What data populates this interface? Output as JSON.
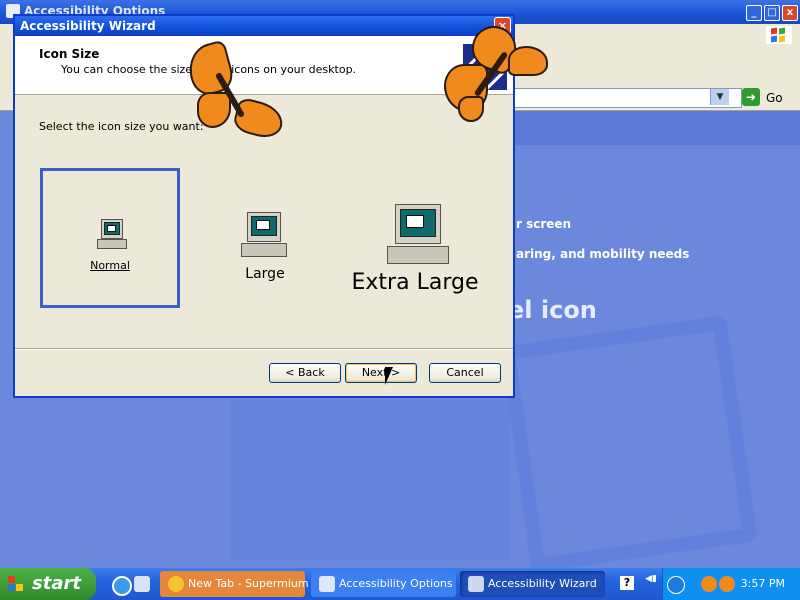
{
  "background_window": {
    "title": "Accessibility Options",
    "go_label": "Go",
    "content_line_1": "r screen",
    "content_line_2": "aring, and mobility needs",
    "heading_fragment": "el icon"
  },
  "wizard": {
    "title": "Accessibility Wizard",
    "header_title": "Icon Size",
    "header_subtitle": "You can choose the size of the icons on your desktop.",
    "prompt": "Select the icon size you want:",
    "options": [
      {
        "label": "Normal",
        "selected": true
      },
      {
        "label": "Large",
        "selected": false
      },
      {
        "label": "Extra Large",
        "selected": false
      }
    ],
    "buttons": {
      "back": "< Back",
      "next": "Next >",
      "cancel": "Cancel"
    }
  },
  "taskbar": {
    "start_label": "start",
    "tasks": [
      {
        "label": "New Tab - Supermium",
        "icon": "browser-icon"
      },
      {
        "label": "Accessibility Options",
        "icon": "accessibility-icon"
      },
      {
        "label": "Accessibility Wizard",
        "icon": "wizard-icon",
        "active": true
      }
    ],
    "clock": "3:57 PM"
  },
  "colors": {
    "titlebar_blue": "#0f4fd8",
    "selection_border": "#3a5fcd",
    "butterfly_orange": "#f08a1c",
    "start_green": "#2f8d2b"
  }
}
